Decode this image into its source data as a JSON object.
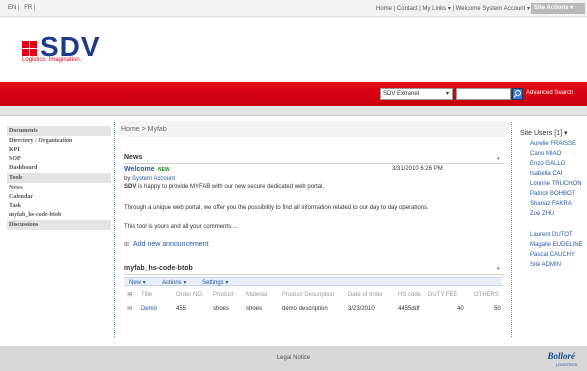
{
  "topbar": {
    "lang_en": "EN |",
    "lang_fr": "FR |",
    "links": "Home | Contact | My Links ▾ | Welcome System Account ▾",
    "site_actions": "Site Actions ▾"
  },
  "header": {
    "logo_text": "SDV",
    "tagline": "Logistics. Imagination."
  },
  "search": {
    "scope": "SDV Extranet",
    "query": "",
    "advanced": "Advanced Search"
  },
  "breadcrumb": "Home > Myfab",
  "leftnav": [
    {
      "label": "Documents",
      "type": "head"
    },
    {
      "label": "Directory / Organization",
      "type": "item"
    },
    {
      "label": "KPI",
      "type": "item"
    },
    {
      "label": "SOP",
      "type": "item"
    },
    {
      "label": "Dashboard",
      "type": "item"
    },
    {
      "label": "Tools",
      "type": "head"
    },
    {
      "label": "News",
      "type": "item"
    },
    {
      "label": "Calendar",
      "type": "item"
    },
    {
      "label": "Task",
      "type": "item"
    },
    {
      "label": "myfab_hs-code-btob",
      "type": "item"
    },
    {
      "label": "Discussions",
      "type": "head"
    }
  ],
  "news": {
    "title": "News",
    "item_title": "Welcome",
    "new_badge": "NEW",
    "by_prefix": "by ",
    "author": "System Account",
    "date": "3/31/2010 6:26 PM",
    "body1_bold": "SDV",
    "body1": " is happy to provide MYFAB with our new secure dedicated web portal.",
    "body2": "Through a unique web portal, we offer you the possibility to find all information related to our day to day operations.",
    "body3": "This tool is yours and all your comments....",
    "add_link": "Add new announcement"
  },
  "list": {
    "title": "myfab_hs-code-btob",
    "toolbar": {
      "new": "New ▾",
      "actions": "Actions ▾",
      "settings": "Settings ▾"
    },
    "columns": [
      "Title",
      "Order NO.",
      "Product",
      "Material",
      "Product Description",
      "Date of order",
      "HS code",
      "DUTY FEE",
      "OTHERS"
    ],
    "rows": [
      [
        "Demo",
        "455",
        "shoes",
        "shoes",
        "demo description",
        "3/23/2010",
        "4455ddf",
        "40",
        "50"
      ]
    ]
  },
  "site_users": {
    "title": "Site Users [1] ▾",
    "users": [
      "Aurelie FRAISSE",
      "Cano MIAO",
      "Enzo GALLO",
      "Isabella CAI",
      "Lorinne TRUCHON",
      "Patrick BOHBOT",
      "Shanaz FAKRA",
      "Zoé ZHU",
      "Laurent DUTOT",
      "Magalie EUDELINE",
      "Pascal CAUCHY",
      "Site ADMIN"
    ]
  },
  "footer": {
    "legal": "Legal Notice",
    "brand": "Bolloré",
    "brand_sub": "LOGISTICS"
  },
  "colors": {
    "brand_red": "#e30613",
    "brand_blue": "#1e3a8a",
    "link_blue": "#2957a4"
  }
}
